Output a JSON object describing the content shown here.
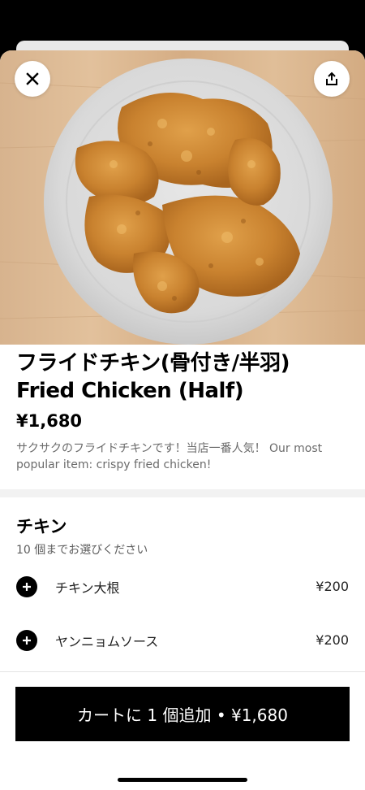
{
  "item": {
    "name_ja": "フライドチキン(骨付き/半羽)",
    "name_en": "Fried Chicken (Half)",
    "price": "¥1,680",
    "description": "サクサクのフライドチキンです！当店一番人気！ Our most popular item: crispy fried chicken!"
  },
  "icons": {
    "close": "close-icon",
    "share": "share-icon",
    "add": "plus-icon"
  },
  "options_section": {
    "title": "チキン",
    "subtitle": "10 個までお選びください",
    "items": [
      {
        "label": "チキン大根",
        "price": "¥200"
      },
      {
        "label": "ヤンニョムソース",
        "price": "¥200"
      }
    ]
  },
  "cart_button": {
    "label": "カートに 1 個追加 • ¥1,680"
  }
}
